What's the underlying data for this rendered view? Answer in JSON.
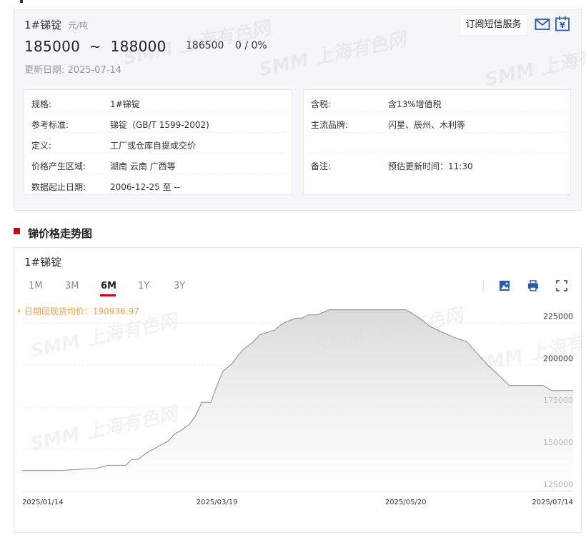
{
  "product": {
    "name": "1#锑锭",
    "unit": "元/吨",
    "price_low": "185000",
    "price_high": "188000",
    "price_separator": "~",
    "average": "186500",
    "change": "0 / 0%",
    "update_label": "更新日期:",
    "update_date": "2025-07-14"
  },
  "actions": {
    "subscribe_label": "订阅短信服务",
    "mail_icon": "mail-icon",
    "calendar_icon": "yen-calendar-icon"
  },
  "specs_left": [
    {
      "key": "规格:",
      "value": "1#锑锭"
    },
    {
      "key": "参考标准:",
      "value": "锑锭（GB/T 1599-2002)"
    },
    {
      "key": "定义:",
      "value": "工厂或仓库自提成交价"
    },
    {
      "key": "价格产生区域:",
      "value": "湖南 云南 广西等"
    },
    {
      "key": "数据起止日期:",
      "value": "2006-12-25 至 --"
    }
  ],
  "specs_right": [
    {
      "key": "含税:",
      "value": "含13%增值税"
    },
    {
      "key": "主流品牌:",
      "value": "闪星、辰州、木利等"
    },
    {
      "key": "",
      "value": ""
    },
    {
      "key": "备注:",
      "value": "预估更新时间：11:30"
    }
  ],
  "section": {
    "title": "锑价格走势图"
  },
  "chart_panel": {
    "series_title": "1#锑锭",
    "tabs": [
      "1M",
      "3M",
      "6M",
      "1Y",
      "3Y"
    ],
    "active_tab": "6M",
    "avg_note": "• 日期段现货均价：190936.97",
    "tools": [
      "download-image-icon",
      "print-icon",
      "fullscreen-icon"
    ]
  },
  "watermark_text": "SMM 上海有色网",
  "colors": {
    "accent_red": "#d0021b",
    "avg_orange": "#f0a040",
    "line_gray": "#9a9a9a"
  },
  "chart_data": {
    "type": "area",
    "title": "",
    "xlabel": "",
    "ylabel": "",
    "x_tick_labels": [
      "2025/01/14",
      "2025/03/19",
      "2025/05/20",
      "2025/07/14"
    ],
    "y_tick_labels": [
      "125000",
      "150000",
      "175000",
      "200000",
      "225000"
    ],
    "ylim": [
      125000,
      237500
    ],
    "grid": true,
    "series": [
      {
        "name": "",
        "x": [
          "2025-01-14",
          "2025-01-17",
          "2025-01-21",
          "2025-01-24",
          "2025-01-27",
          "2025-02-05",
          "2025-02-07",
          "2025-02-11",
          "2025-02-13",
          "2025-02-17",
          "2025-02-19",
          "2025-02-21",
          "2025-02-24",
          "2025-02-26",
          "2025-02-28",
          "2025-03-03",
          "2025-03-05",
          "2025-03-07",
          "2025-03-10",
          "2025-03-12",
          "2025-03-14",
          "2025-03-17",
          "2025-03-19",
          "2025-03-21",
          "2025-03-24",
          "2025-03-26",
          "2025-03-28",
          "2025-03-31",
          "2025-04-02",
          "2025-04-07",
          "2025-04-09",
          "2025-04-11",
          "2025-04-14",
          "2025-04-16",
          "2025-04-18",
          "2025-04-21",
          "2025-04-23",
          "2025-04-25",
          "2025-04-28",
          "2025-04-30",
          "2025-05-06",
          "2025-05-08",
          "2025-05-10",
          "2025-05-13",
          "2025-05-15",
          "2025-05-20",
          "2025-05-22",
          "2025-05-26",
          "2025-05-28",
          "2025-06-03",
          "2025-06-05",
          "2025-06-09",
          "2025-06-12",
          "2025-06-16",
          "2025-06-19",
          "2025-06-23",
          "2025-06-25",
          "2025-06-27",
          "2025-07-01",
          "2025-07-04",
          "2025-07-07",
          "2025-07-09",
          "2025-07-11",
          "2025-07-14"
        ],
        "values": [
          137500,
          137500,
          137500,
          137500,
          137500,
          138500,
          138500,
          140500,
          140500,
          140500,
          144000,
          144000,
          148000,
          150000,
          152000,
          155000,
          159000,
          161000,
          165000,
          170000,
          178000,
          178000,
          188000,
          196500,
          201000,
          206000,
          210000,
          214000,
          218000,
          221000,
          224000,
          226000,
          228000,
          228000,
          230000,
          230000,
          231500,
          233000,
          233000,
          233000,
          233000,
          233000,
          233000,
          233000,
          233000,
          233000,
          231000,
          226000,
          223000,
          218000,
          216500,
          214000,
          208000,
          200000,
          195000,
          188000,
          188000,
          188000,
          188000,
          188000,
          185000,
          185000,
          185000,
          185000
        ]
      }
    ]
  }
}
